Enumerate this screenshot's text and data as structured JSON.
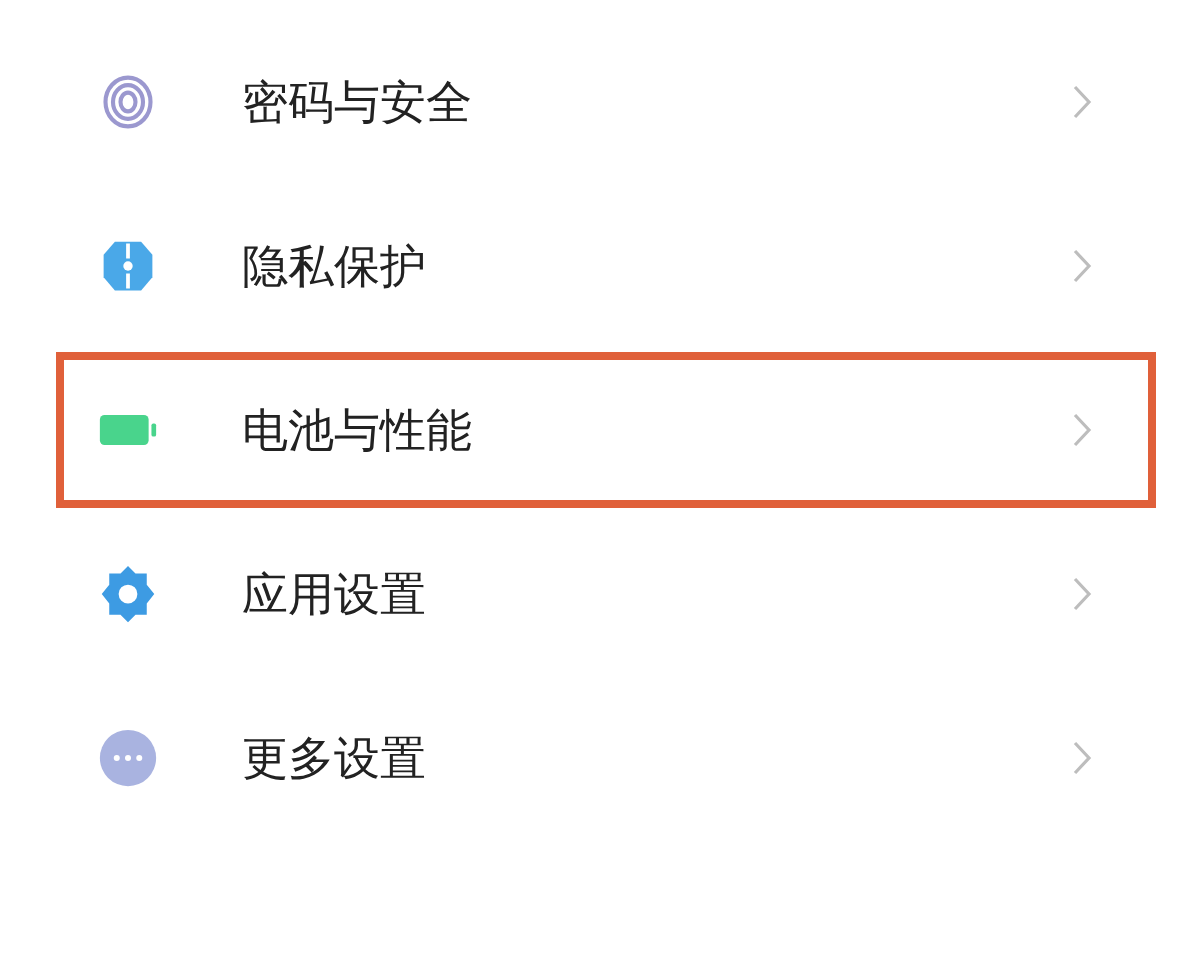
{
  "settings_items": [
    {
      "label": "密码与安全",
      "kind": "fingerprint",
      "highlighted": false
    },
    {
      "label": "隐私保护",
      "kind": "shield",
      "highlighted": false
    },
    {
      "label": "电池与性能",
      "kind": "battery",
      "highlighted": true
    },
    {
      "label": "应用设置",
      "kind": "gear",
      "highlighted": false
    },
    {
      "label": "更多设置",
      "kind": "more",
      "highlighted": false
    }
  ]
}
